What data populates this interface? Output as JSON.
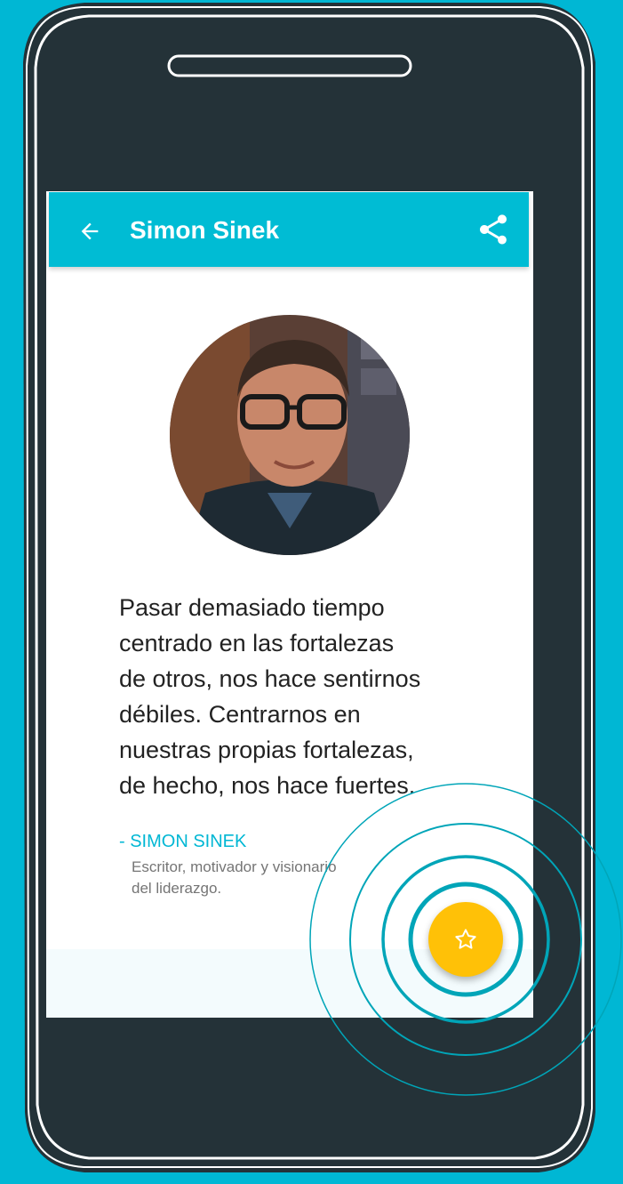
{
  "app_bar": {
    "title": "Simon Sinek",
    "back_icon": "arrow-back-icon",
    "share_icon": "share-icon"
  },
  "quote": {
    "lines": [
      "Pasar demasiado tiempo",
      "centrado en las fortalezas",
      "de otros, nos hace sentirnos",
      "débiles. Centrarnos en",
      "nuestras propias fortalezas,",
      "de hecho, nos hace fuertes."
    ]
  },
  "author": {
    "name": "- SIMON SINEK",
    "description_lines": [
      "Escritor, motivador y visionario",
      "del liderazgo."
    ]
  },
  "fab": {
    "icon": "star-outline-icon"
  },
  "colors": {
    "background": "#00b7d4",
    "app_bar": "#00bcd4",
    "phone_body": "#243238",
    "fab": "#ffc107",
    "accent_text": "#00b7d4",
    "ring": "#00a5b8"
  }
}
